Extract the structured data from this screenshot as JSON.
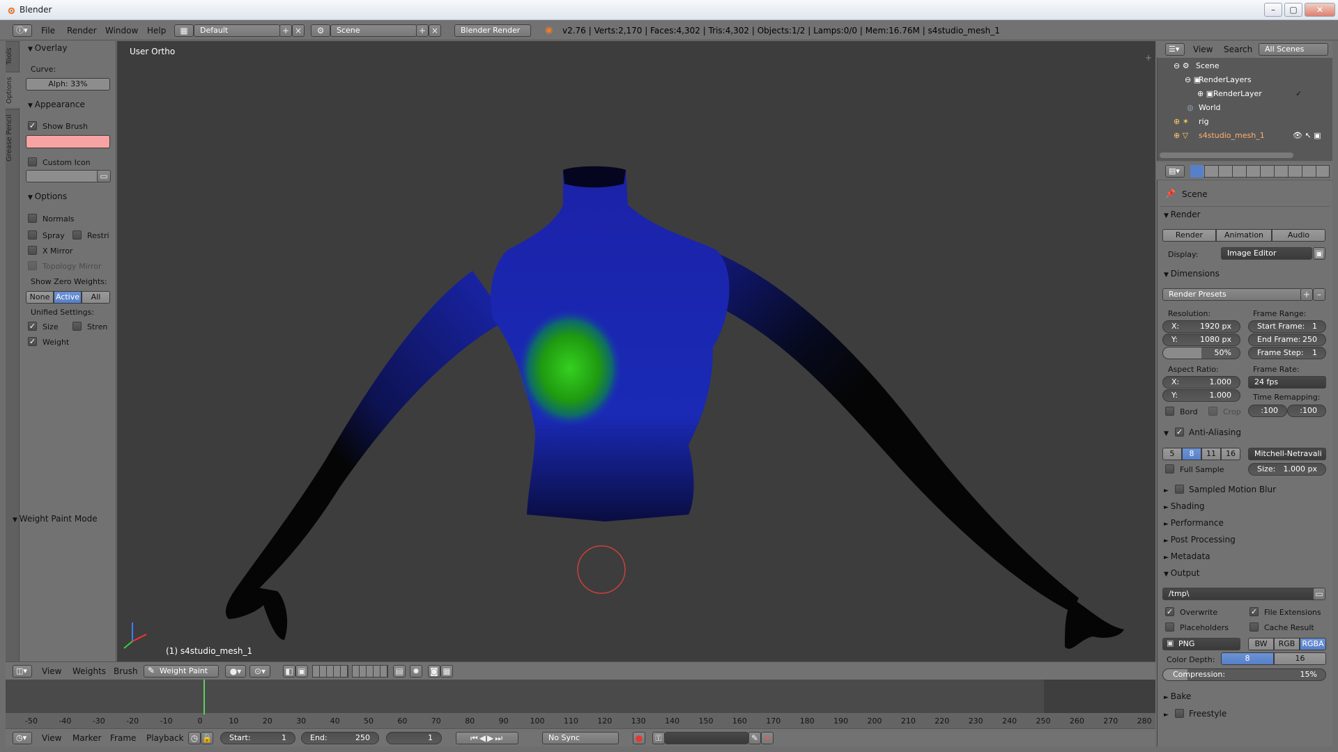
{
  "window": {
    "title": "Blender"
  },
  "info_header": {
    "menus": [
      "File",
      "Render",
      "Window",
      "Help"
    ],
    "screen_layout": "Default",
    "scene": "Scene",
    "render_engine": "Blender Render",
    "stats": "v2.76 | Verts:2,170 | Faces:4,302 | Tris:4,302 | Objects:1/2 | Lamps:0/0 | Mem:16.76M | s4studio_mesh_1"
  },
  "toolshelf": {
    "tabs": [
      "Tools",
      "Options",
      "Grease Pencil"
    ],
    "overlay": {
      "title": "Overlay",
      "curve_label": "Curve:",
      "alpha": "Alph: 33%"
    },
    "appearance": {
      "title": "Appearance",
      "show_brush": "Show Brush",
      "custom_icon": "Custom Icon",
      "brush_color": "#f7a3a3"
    },
    "options": {
      "title": "Options",
      "normals": "Normals",
      "spray": "Spray",
      "restrict": "Restri",
      "x_mirror": "X Mirror",
      "topology_mirror": "Topology Mirror",
      "zero_weights_label": "Show Zero Weights:",
      "zero_weights": [
        "None",
        "Active",
        "All"
      ],
      "unified_label": "Unified Settings:",
      "size": "Size",
      "strength": "Stren",
      "weight": "Weight"
    },
    "mode_panel": "Weight Paint Mode"
  },
  "viewport": {
    "label": "User Ortho",
    "object": "(1) s4studio_mesh_1"
  },
  "view3d_header": {
    "menus": [
      "View",
      "Weights",
      "Brush"
    ],
    "mode": "Weight Paint"
  },
  "timeline": {
    "ticks": [
      "-50",
      "-40",
      "-30",
      "-20",
      "-10",
      "0",
      "10",
      "20",
      "30",
      "40",
      "50",
      "60",
      "70",
      "80",
      "90",
      "100",
      "110",
      "120",
      "130",
      "140",
      "150",
      "160",
      "170",
      "180",
      "190",
      "200",
      "210",
      "220",
      "230",
      "240",
      "250",
      "260",
      "270",
      "280"
    ],
    "current_frame": 1,
    "menus": [
      "View",
      "Marker",
      "Frame",
      "Playback"
    ],
    "start": "Start:",
    "start_value": "1",
    "end": "End:",
    "end_value": "250",
    "frame": "1",
    "sync": "No Sync"
  },
  "outliner": {
    "menus": [
      "View",
      "Search"
    ],
    "filter": "All Scenes",
    "items": [
      "Scene",
      "RenderLayers",
      "RenderLayer",
      "World",
      "rig",
      "s4studio_mesh_1"
    ]
  },
  "properties": {
    "context": "Scene",
    "render": {
      "title": "Render",
      "render_btn": "Render",
      "animation_btn": "Animation",
      "audio_btn": "Audio",
      "display_label": "Display:",
      "display_value": "Image Editor"
    },
    "dimensions": {
      "title": "Dimensions",
      "presets": "Render Presets",
      "resolution_label": "Resolution:",
      "res_x_k": "X:",
      "res_x": "1920 px",
      "res_y_k": "Y:",
      "res_y": "1080 px",
      "res_pct": "50%",
      "frame_range_label": "Frame Range:",
      "start_k": "Start Frame:",
      "start": "1",
      "end_k": "End Frame:",
      "end": "250",
      "step_k": "Frame Step:",
      "step": "1",
      "aspect_label": "Aspect Ratio:",
      "asp_x_k": "X:",
      "asp_x": "1.000",
      "asp_y_k": "Y:",
      "asp_y": "1.000",
      "frame_rate_label": "Frame Rate:",
      "fps": "24 fps",
      "time_remap_label": "Time Remapping:",
      "remap_old": ":100",
      "remap_new": ":100",
      "border": "Bord",
      "crop": "Crop"
    },
    "anti_aliasing": {
      "title": "Anti-Aliasing",
      "samples": [
        "5",
        "8",
        "11",
        "16"
      ],
      "filter": "Mitchell-Netravali",
      "full_sample": "Full Sample",
      "size_k": "Size:",
      "size": "1.000 px"
    },
    "collapsed": [
      "Sampled Motion Blur",
      "Shading",
      "Performance",
      "Post Processing",
      "Metadata"
    ],
    "output": {
      "title": "Output",
      "path": "/tmp\\",
      "overwrite": "Overwrite",
      "file_ext": "File Extensions",
      "placeholders": "Placeholders",
      "cache": "Cache Result",
      "format": "PNG",
      "bw": "BW",
      "rgb": "RGB",
      "rgba": "RGBA",
      "depth_label": "Color Depth:",
      "depth8": "8",
      "depth16": "16",
      "compression": "Compression:",
      "compression_value": "15%"
    },
    "bake": "Bake",
    "freestyle": "Freestyle"
  }
}
